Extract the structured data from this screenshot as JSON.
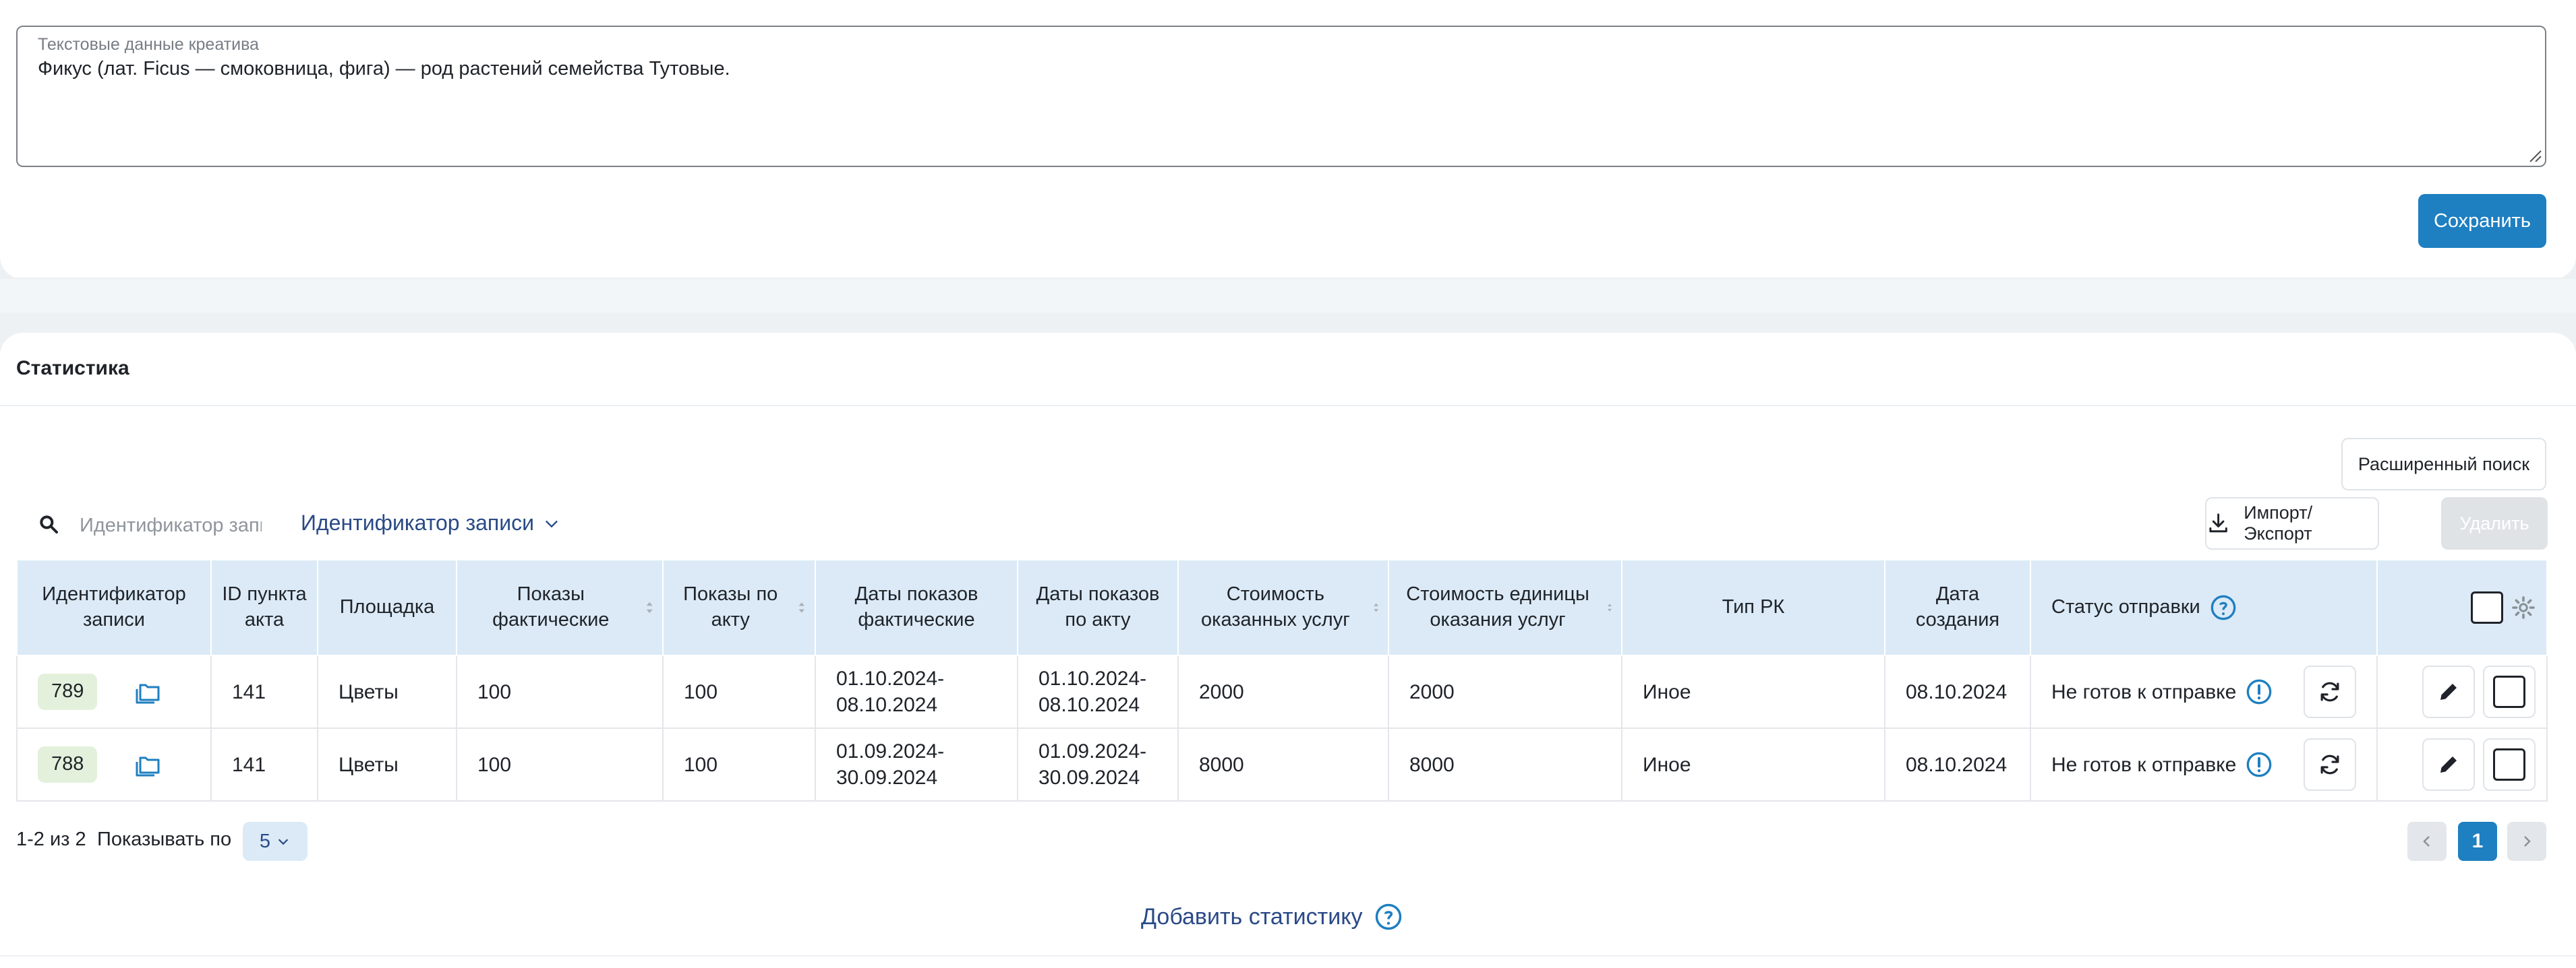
{
  "creative_text": {
    "label": "Текстовые данные креатива",
    "value": "Фикус (лат. Ficus — смоковница, фига) — род растений семейства Тутовые."
  },
  "save_button": "Сохранить",
  "section": {
    "title": "Статистика"
  },
  "toolbar": {
    "advanced_search": "Расширенный поиск",
    "import_export": "Импорт/Экспорт",
    "delete": "Удалить",
    "search_placeholder": "Идентификатор записи",
    "filter_field": "Идентификатор записи"
  },
  "table": {
    "headers": {
      "record_id": "Идентификатор записи",
      "act_item_id": "ID пункта акта",
      "platform": "Площадка",
      "impressions_actual": "Показы фактические",
      "impressions_act": "Показы по акту",
      "dates_actual": "Даты показов фактические",
      "dates_act": "Даты показов по акту",
      "cost_services": "Стоимость оказанных услуг",
      "cost_unit": "Стоимость единицы оказания услуг",
      "campaign_type": "Тип РК",
      "created_date": "Дата создания",
      "send_status": "Статус отправки"
    },
    "rows": [
      {
        "record_id": "789",
        "act_item_id": "141",
        "platform": "Цветы",
        "impressions_actual": "100",
        "impressions_act": "100",
        "dates_actual": "01.10.2024-08.10.2024",
        "dates_act": "01.10.2024-08.10.2024",
        "cost_services": "2000",
        "cost_unit": "2000",
        "campaign_type": "Иное",
        "created_date": "08.10.2024",
        "send_status": "Не готов к отправке"
      },
      {
        "record_id": "788",
        "act_item_id": "141",
        "platform": "Цветы",
        "impressions_actual": "100",
        "impressions_act": "100",
        "dates_actual": "01.09.2024-30.09.2024",
        "dates_act": "01.09.2024-30.09.2024",
        "cost_services": "8000",
        "cost_unit": "8000",
        "campaign_type": "Иное",
        "created_date": "08.10.2024",
        "send_status": "Не готов к отправке"
      }
    ]
  },
  "pagination": {
    "range": "1-2 из 2",
    "show_label": "Показывать по",
    "page_size": "5",
    "current_page": "1"
  },
  "add_statistics": "Добавить статистику",
  "colors": {
    "accent": "#1e7fc1",
    "header_bg": "#dbeaf6",
    "id_badge_bg": "#e3f1dc",
    "link": "#2a4a86"
  }
}
